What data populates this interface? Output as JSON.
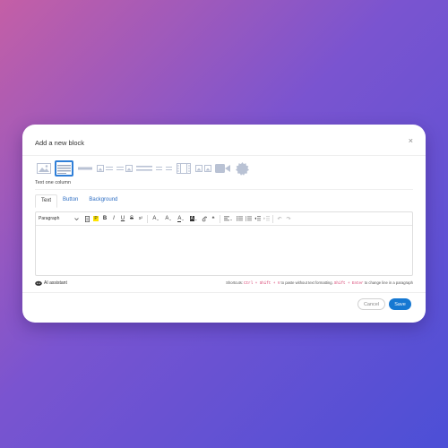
{
  "modal": {
    "title": "Add a new block",
    "close_glyph": "×"
  },
  "blocks": {
    "selected_caption": "Text one column",
    "items": [
      {
        "name": "image-block",
        "icon": "image-icon"
      },
      {
        "name": "text-one-column-block",
        "icon": "text-lines-icon",
        "selected": true
      },
      {
        "name": "divider-block",
        "icon": "divider-icon"
      },
      {
        "name": "image-text-block",
        "icon": "image-text-icon"
      },
      {
        "name": "text-image-block",
        "icon": "text-image-icon"
      },
      {
        "name": "text-two-columns-block",
        "icon": "text-columns-icon"
      },
      {
        "name": "two-column-block",
        "icon": "two-columns-icon"
      },
      {
        "name": "video-strip-block",
        "icon": "film-icon"
      },
      {
        "name": "two-images-block",
        "icon": "two-images-icon"
      },
      {
        "name": "video-block",
        "icon": "video-camera-icon"
      },
      {
        "name": "badge-block",
        "icon": "badge-icon"
      }
    ]
  },
  "tabs": [
    {
      "label": "Text",
      "active": true
    },
    {
      "label": "Button",
      "active": false
    },
    {
      "label": "Background",
      "active": false
    }
  ],
  "toolbar": {
    "paragraph": "Paragraph",
    "bold": "B",
    "italic": "I",
    "underline": "U",
    "strike": "S",
    "superscript": "x²",
    "highlight": "P",
    "font_size": "A",
    "font_family": "A",
    "font_color": "A",
    "bg_color": "A",
    "quote": "❝",
    "undo": "↶",
    "redo": "↷"
  },
  "footer": {
    "ai_label": "AI assistant",
    "shortcuts_prefix": "Shortcuts: ",
    "shortcut1": "Ctrl + Shift + V",
    "shortcuts_mid": " to paste without text formatting. ",
    "shortcut2": "Shift + Enter",
    "shortcuts_suffix": " to change line in a paragraph"
  },
  "actions": {
    "cancel": "Cancel",
    "save": "Save"
  },
  "colors": {
    "accent": "#1678d2",
    "link": "#2f6fc4",
    "shortcut": "#d63a6b",
    "icon": "#b9c2d4"
  }
}
